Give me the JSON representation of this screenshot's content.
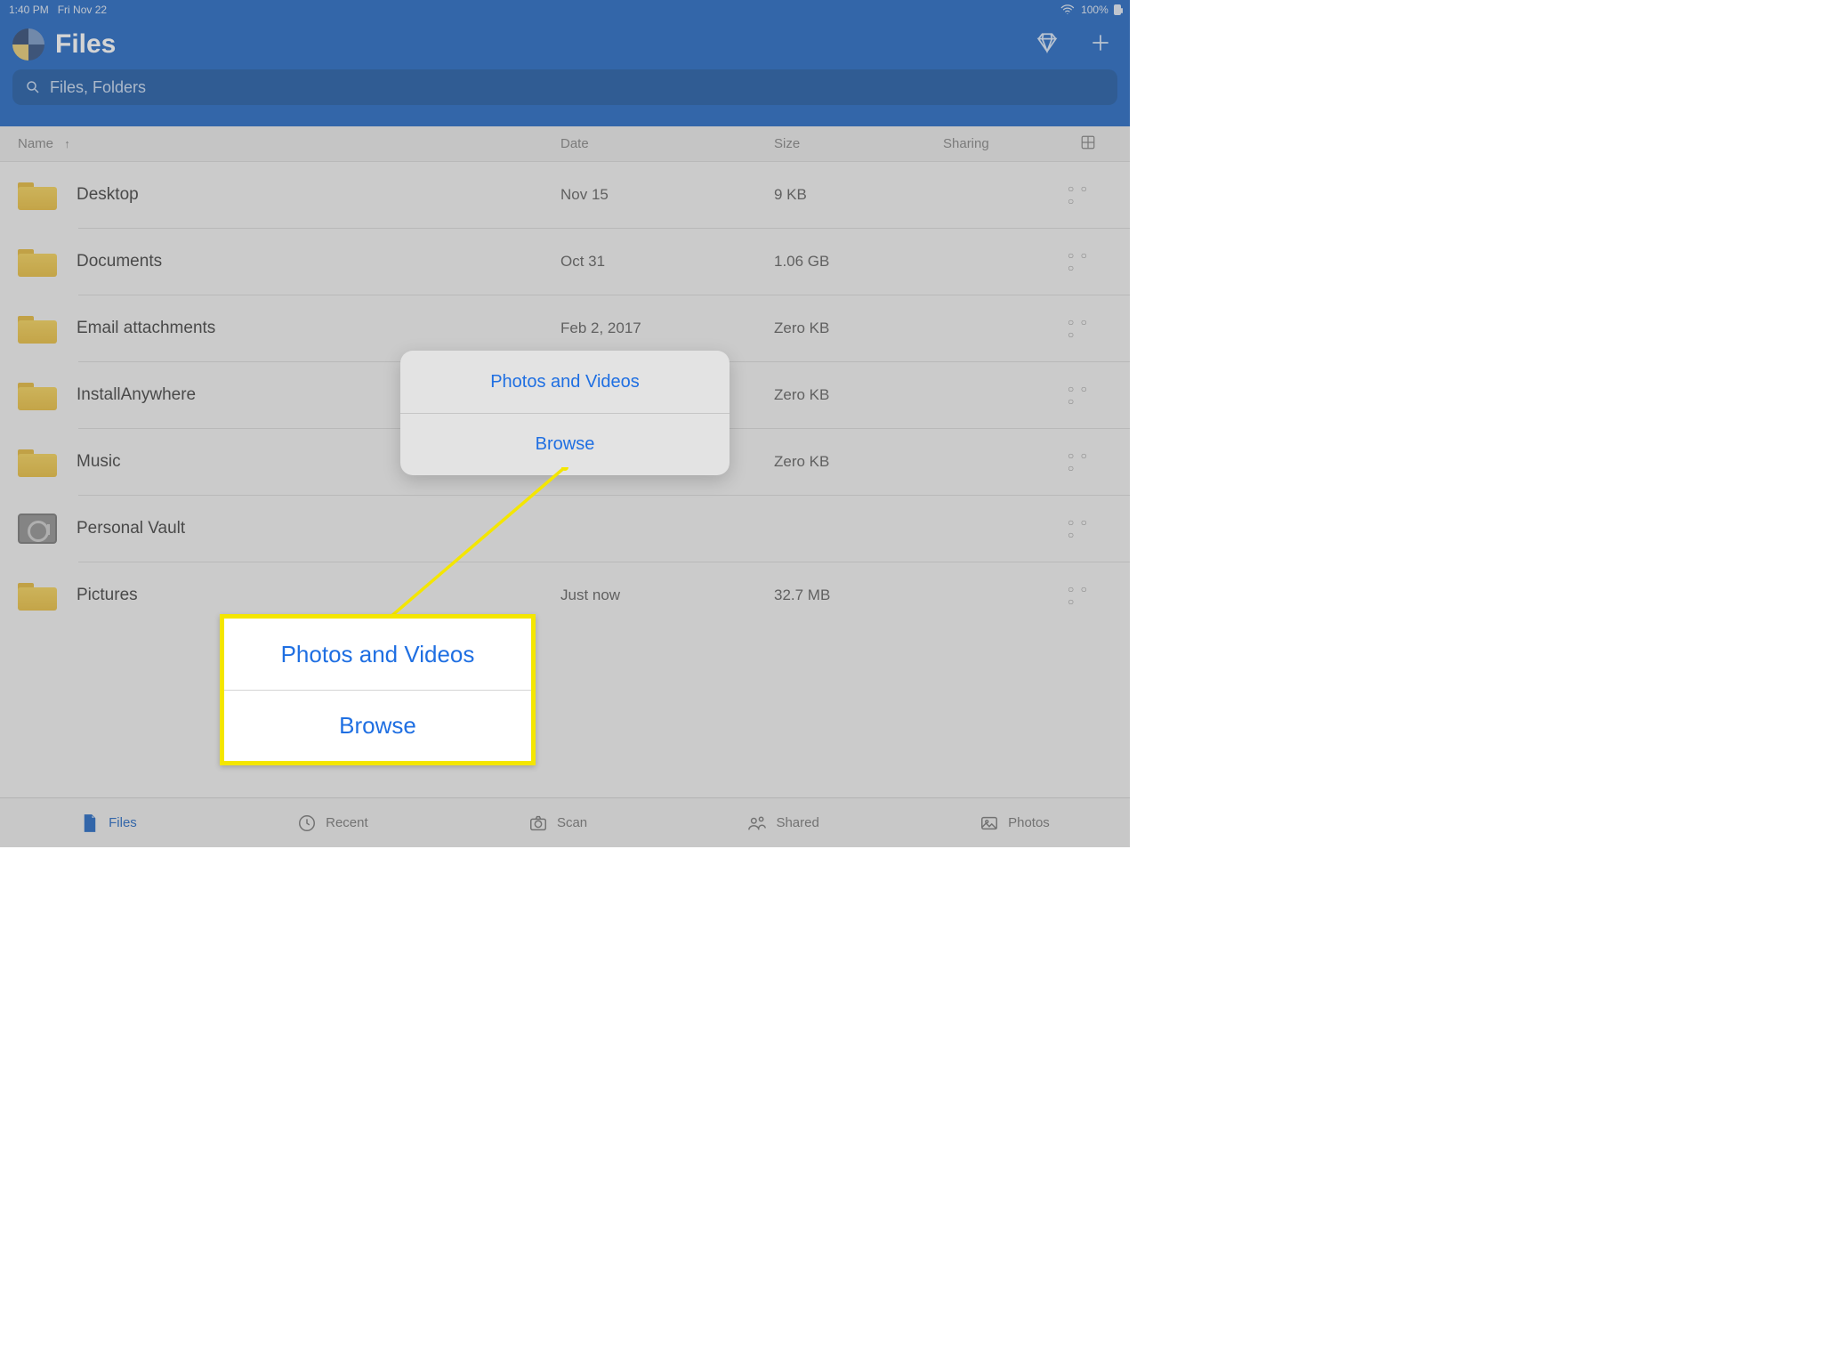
{
  "status": {
    "time": "1:40 PM",
    "date": "Fri Nov 22",
    "battery_pct": "100%"
  },
  "header": {
    "title": "Files"
  },
  "search": {
    "placeholder": "Files, Folders"
  },
  "columns": {
    "name": "Name",
    "date": "Date",
    "size": "Size",
    "sharing": "Sharing"
  },
  "rows": [
    {
      "icon": "folder",
      "name": "Desktop",
      "date": "Nov 15",
      "size": "9 KB"
    },
    {
      "icon": "folder",
      "name": "Documents",
      "date": "Oct 31",
      "size": "1.06 GB"
    },
    {
      "icon": "folder",
      "name": "Email attachments",
      "date": "Feb 2, 2017",
      "size": "Zero KB"
    },
    {
      "icon": "folder",
      "name": "InstallAnywhere",
      "date": "",
      "size": "Zero KB"
    },
    {
      "icon": "folder",
      "name": "Music",
      "date": "",
      "size": "Zero KB"
    },
    {
      "icon": "vault",
      "name": "Personal Vault",
      "date": "",
      "size": ""
    },
    {
      "icon": "folder",
      "name": "Pictures",
      "date": "Just now",
      "size": "32.7 MB"
    }
  ],
  "popover": {
    "opt1": "Photos and Videos",
    "opt2": "Browse"
  },
  "callout": {
    "opt1": "Photos and Videos",
    "opt2": "Browse"
  },
  "tabs": {
    "files": "Files",
    "recent": "Recent",
    "scan": "Scan",
    "shared": "Shared",
    "photos": "Photos"
  }
}
